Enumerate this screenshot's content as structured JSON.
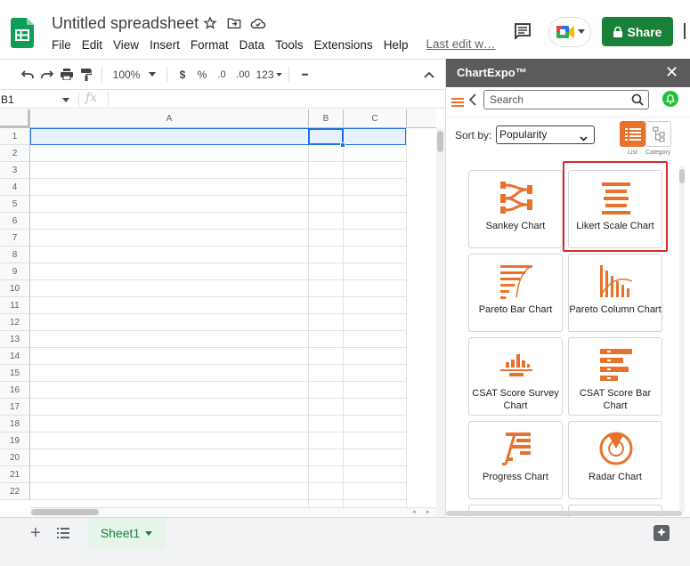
{
  "header": {
    "title": "Untitled spreadsheet",
    "menu": [
      "File",
      "Edit",
      "View",
      "Insert",
      "Format",
      "Data",
      "Tools",
      "Extensions",
      "Help"
    ],
    "last_edit": "Last edit w…",
    "share_label": "Share"
  },
  "toolbar": {
    "zoom": "100%",
    "currency": "$",
    "percent": "%",
    "decrease_decimals": ".0",
    "increase_decimals": ".00",
    "number_format": "123",
    "more": "•••"
  },
  "formula_bar": {
    "cell_ref": "B1",
    "fx": "fx"
  },
  "grid": {
    "columns": [
      "A",
      "B",
      "C"
    ],
    "rows": [
      "1",
      "2",
      "3",
      "4",
      "5",
      "6",
      "7",
      "8",
      "9",
      "10",
      "11",
      "12",
      "13",
      "14",
      "15",
      "16",
      "17",
      "18",
      "19",
      "20",
      "21",
      "22"
    ]
  },
  "bottom": {
    "sheet_name": "Sheet1"
  },
  "chartexpo": {
    "title": "ChartExpo™",
    "search_placeholder": "Search",
    "sort_label": "Sort by:",
    "sort_value": "Popularity",
    "view_list_label": "List",
    "view_category_label": "Category",
    "accent_color": "#E8722C",
    "highlight_color": "#D32F2F",
    "charts": [
      {
        "label": "Sankey Chart",
        "icon": "sankey-icon"
      },
      {
        "label": "Likert Scale Chart",
        "icon": "likert-icon",
        "highlighted": true
      },
      {
        "label": "Pareto Bar Chart",
        "icon": "pareto-bar-icon"
      },
      {
        "label": "Pareto Column Chart",
        "icon": "pareto-column-icon"
      },
      {
        "label": "CSAT Score Survey Chart",
        "icon": "csat-survey-icon"
      },
      {
        "label": "CSAT Score Bar Chart",
        "icon": "csat-bar-icon"
      },
      {
        "label": "Progress Chart",
        "icon": "progress-icon"
      },
      {
        "label": "Radar Chart",
        "icon": "radar-icon"
      }
    ]
  }
}
